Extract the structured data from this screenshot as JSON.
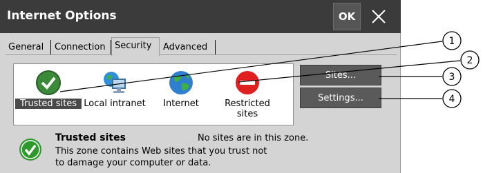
{
  "window": {
    "title": "Internet Options",
    "ok_label": "OK"
  },
  "tabs": [
    {
      "label": "General"
    },
    {
      "label": "Connection"
    },
    {
      "label": "Security",
      "active": true
    },
    {
      "label": "Advanced"
    }
  ],
  "zones": [
    {
      "label": "Trusted sites",
      "icon": "trusted-sites-icon",
      "selected": true
    },
    {
      "label": "Local intranet",
      "icon": "local-intranet-icon"
    },
    {
      "label": "Internet",
      "icon": "internet-globe-icon"
    },
    {
      "label": "Restricted sites",
      "icon": "restricted-sites-icon"
    }
  ],
  "buttons": {
    "sites": "Sites...",
    "settings": "Settings..."
  },
  "info": {
    "title": "Trusted sites",
    "status": "No sites are in this zone.",
    "description": "This zone contains Web sites that you trust not to damage your computer or data."
  },
  "callouts": [
    "1",
    "2",
    "3",
    "4"
  ],
  "colors": {
    "titlebar": "#3b3b3b",
    "dialog_bg": "#d4d4d4",
    "button_bg": "#5a5a5a",
    "trusted_green": "#3a8a3a",
    "restricted_red": "#e02020"
  }
}
